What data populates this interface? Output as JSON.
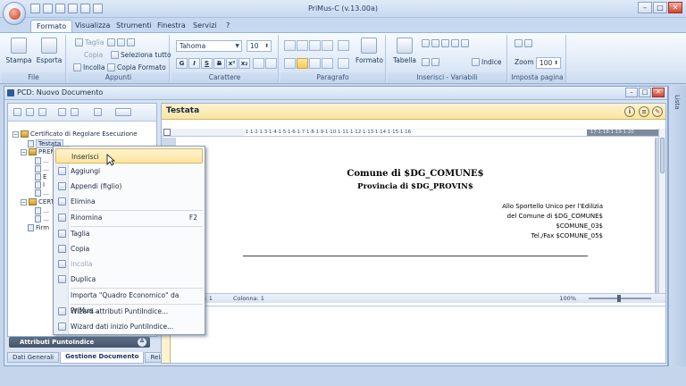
{
  "app": {
    "title": "PriMus-C  (v.13.00a)",
    "window_buttons": [
      "–",
      "□",
      "✕"
    ]
  },
  "ribbon": {
    "tabs": [
      {
        "label": "Formato",
        "active": true
      },
      {
        "label": "Visualizza",
        "active": false
      },
      {
        "label": "Strumenti",
        "active": false
      },
      {
        "label": "Finestra",
        "active": false
      },
      {
        "label": "Servizi",
        "active": false
      },
      {
        "label": "?",
        "active": false
      }
    ],
    "groups": {
      "file": {
        "label": "File",
        "stampa": "Stampa",
        "esporta": "Esporta"
      },
      "appunti": {
        "label": "Appunti",
        "taglia": "Taglia",
        "copia": "Copia",
        "incolla": "Incolla",
        "seleziona_tutto": "Seleziona tutto",
        "copia_formato": "Copia Formato"
      },
      "carattere": {
        "label": "Carattere",
        "font": "Tahoma",
        "size": "10",
        "format_buttons": [
          "G",
          "I",
          "S",
          "B",
          "x²",
          "x₂"
        ]
      },
      "paragrafo": {
        "label": "Paragrafo",
        "formato": "Formato"
      },
      "inserisci": {
        "label": "Inserisci - Variabili",
        "tabella": "Tabella",
        "indice": "Indice"
      },
      "imposta": {
        "label": "Imposta pagina",
        "zoom_label": "Zoom",
        "zoom_value": "100"
      }
    }
  },
  "side_panel": {
    "label": "Lista"
  },
  "doc_window": {
    "title": "PCD: Nuovo Documento",
    "tree": [
      {
        "label": "Certificato di Regolare Esecuzione",
        "level": 0,
        "expanded": true
      },
      {
        "label": "Testata",
        "level": 1,
        "selected": true
      },
      {
        "label": "PREM",
        "level": 1,
        "expanded": true
      },
      {
        "label": "…",
        "level": 2
      },
      {
        "label": "…",
        "level": 2
      },
      {
        "label": "E",
        "level": 2
      },
      {
        "label": "I",
        "level": 2
      },
      {
        "label": "…",
        "level": 2
      },
      {
        "label": "CERT",
        "level": 1,
        "expanded": true
      },
      {
        "label": "…",
        "level": 2
      },
      {
        "label": "…",
        "level": 2
      },
      {
        "label": "Firm",
        "level": 1
      }
    ],
    "attr_bar": "Attributi PuntoIndice",
    "bottom_tabs": [
      {
        "label": "Dati Generali",
        "active": false
      },
      {
        "label": "Gestione Documento",
        "active": true
      },
      {
        "label": "Relazione",
        "active": false
      }
    ],
    "editor": {
      "header_title": "Testata",
      "ruler_text": "·1·1·2·1·3·1·4·1·5·1·6·1·7·1·8·1·9·1·10·1·11·1·12·1·13·1·14·1·15·1·16·",
      "ruler_dark_text": "·17·1·18·1·19·1·20",
      "heading1": "Comune di $DG_COMUNE$",
      "heading2": "Provincia di $DG_PROVIN$",
      "address_lines": [
        "Allo Sportello Unico per l'Edilizia",
        "del Comune di $DG_COMUNE$",
        "$COMUNE_03$",
        "Tel./Fax $COMUNE_05$"
      ],
      "status": {
        "riga": "Riga: 1",
        "colonna": "Colonna: 1",
        "zoom": "100%"
      }
    }
  },
  "context_menu": {
    "items": [
      {
        "label": "Inserisci",
        "highlighted": true,
        "disabled": false,
        "shortcut": ""
      },
      {
        "label": "Aggiungi",
        "highlighted": false,
        "disabled": false,
        "shortcut": ""
      },
      {
        "label": "Appendi (figlio)",
        "highlighted": false,
        "disabled": false,
        "shortcut": ""
      },
      {
        "label": "Elimina",
        "highlighted": false,
        "disabled": false,
        "shortcut": ""
      },
      {
        "label": "Rinomina",
        "highlighted": false,
        "disabled": false,
        "shortcut": "F2"
      },
      {
        "label": "Taglia",
        "highlighted": false,
        "disabled": false,
        "shortcut": ""
      },
      {
        "label": "Copia",
        "highlighted": false,
        "disabled": false,
        "shortcut": ""
      },
      {
        "label": "Incolla",
        "highlighted": false,
        "disabled": true,
        "shortcut": ""
      },
      {
        "label": "Duplica",
        "highlighted": false,
        "disabled": false,
        "shortcut": ""
      },
      {
        "label": "Importa \"Quadro Economico\" da PriMus...",
        "highlighted": false,
        "disabled": false,
        "shortcut": ""
      },
      {
        "label": "Wizard attributi PuntiIndice...",
        "highlighted": false,
        "disabled": false,
        "shortcut": ""
      },
      {
        "label": "Wizard dati inizio PuntiIndice...",
        "highlighted": false,
        "disabled": false,
        "shortcut": ""
      }
    ]
  },
  "colors": {
    "accent": "#fde59b",
    "header_yellow": "#f9e4a0",
    "ribbon_blue": "#c6d8ef",
    "close_red": "#d3412e"
  }
}
